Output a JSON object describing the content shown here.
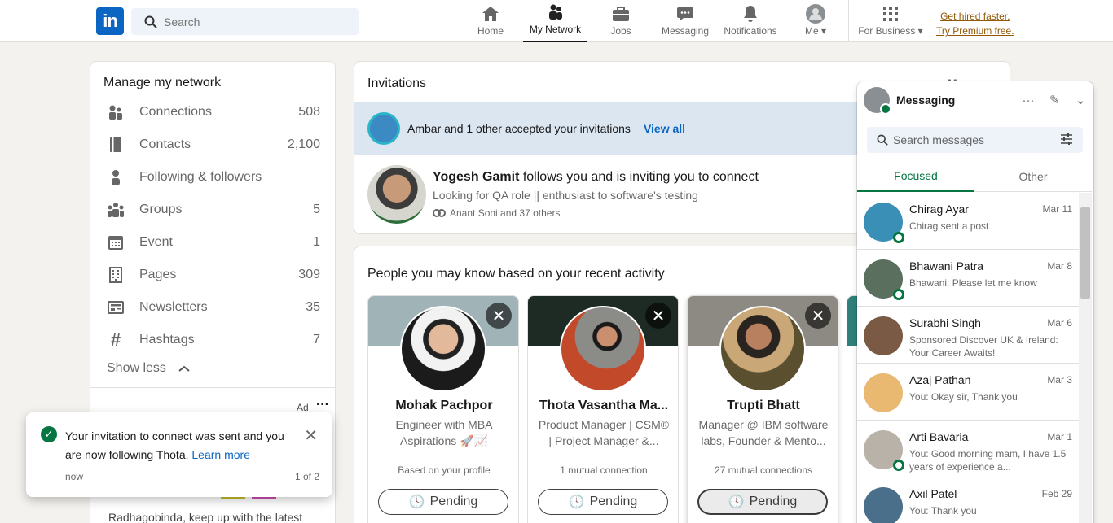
{
  "header": {
    "logo_text": "in",
    "search_placeholder": "Search",
    "nav": [
      {
        "label": "Home",
        "icon": "home-icon"
      },
      {
        "label": "My Network",
        "icon": "network-icon"
      },
      {
        "label": "Jobs",
        "icon": "briefcase-icon"
      },
      {
        "label": "Messaging",
        "icon": "chat-icon"
      },
      {
        "label": "Notifications",
        "icon": "bell-icon"
      },
      {
        "label": "Me",
        "icon": "avatar-icon"
      },
      {
        "label": "For Business",
        "icon": "grid-icon"
      }
    ],
    "premium_line1": "Get hired faster.",
    "premium_line2": "Try Premium free."
  },
  "manage": {
    "title": "Manage my network",
    "items": [
      {
        "label": "Connections",
        "count": "508"
      },
      {
        "label": "Contacts",
        "count": "2,100"
      },
      {
        "label": "Following & followers",
        "count": ""
      },
      {
        "label": "Groups",
        "count": "5"
      },
      {
        "label": "Event",
        "count": "1"
      },
      {
        "label": "Pages",
        "count": "309"
      },
      {
        "label": "Newsletters",
        "count": "35"
      },
      {
        "label": "Hashtags",
        "count": "7"
      }
    ],
    "show_less": "Show less",
    "ad_label": "Ad",
    "ad_text": "Radhagobinda, keep up with the latest"
  },
  "invitations": {
    "title": "Invitations",
    "manage": "Manage",
    "banner_text": "Ambar and 1 other accepted your invitations",
    "view_all": "View all",
    "invite_name": "Yogesh Gamit",
    "invite_rest": " follows you and is inviting you to connect",
    "invite_sub": "Looking for QA role || enthusiast to software's testing",
    "invite_mutual": "Anant Soni and 37 others"
  },
  "people": {
    "title": "People you may know based on your recent activity",
    "cards": [
      {
        "name": "Mohak Pachpor",
        "headline": "Engineer with MBA Aspirations 🚀📈",
        "meta": "Based on your profile",
        "button": "Pending"
      },
      {
        "name": "Thota Vasantha Ma...",
        "headline": "Product Manager | CSM® | Project Manager &...",
        "meta": "1 mutual connection",
        "button": "Pending"
      },
      {
        "name": "Trupti Bhatt",
        "headline": "Manager @ IBM software labs, Founder & Mento...",
        "meta": "27 mutual connections",
        "button": "Pending"
      }
    ]
  },
  "toast": {
    "message": "Your invitation to connect was sent and you are now following Thota.",
    "link": "Learn more",
    "time": "now",
    "pager": "1 of 2"
  },
  "messaging": {
    "title": "Messaging",
    "search_placeholder": "Search messages",
    "tab_focused": "Focused",
    "tab_other": "Other",
    "conversations": [
      {
        "name": "Chirag Ayar",
        "date": "Mar 11",
        "preview": "Chirag sent a post",
        "color": "#3a8fb7",
        "online": true
      },
      {
        "name": "Bhawani Patra",
        "date": "Mar 8",
        "preview": "Bhawani: Please let me know",
        "color": "#5b6f5e",
        "online": true
      },
      {
        "name": "Surabhi Singh",
        "date": "Mar 6",
        "preview": "Sponsored  Discover UK & Ireland: Your Career Awaits!",
        "color": "#7a5a44",
        "online": false
      },
      {
        "name": "Azaj Pathan",
        "date": "Mar 3",
        "preview": "You: Okay sir, Thank you",
        "color": "#e9b871",
        "online": false
      },
      {
        "name": "Arti Bavaria",
        "date": "Mar 1",
        "preview": "You: Good morning mam, I have 1.5 years of experience a...",
        "color": "#b9b2a9",
        "online": true
      },
      {
        "name": "Axil Patel",
        "date": "Feb 29",
        "preview": "You: Thank you",
        "color": "#4a6f8a",
        "online": false
      }
    ]
  }
}
